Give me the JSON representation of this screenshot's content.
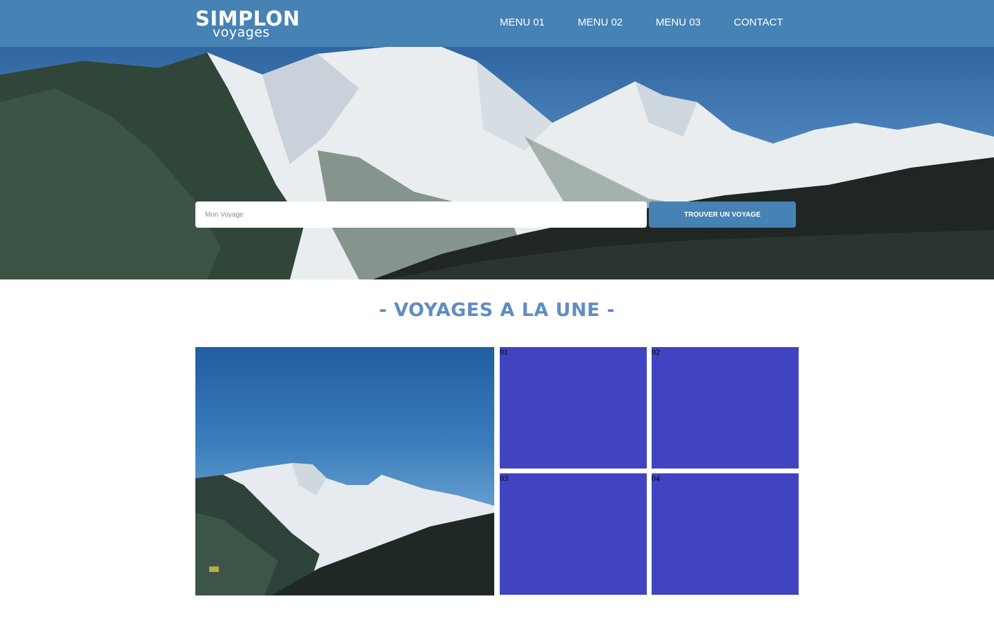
{
  "header": {
    "logo_main": "SIMPLON",
    "logo_sub": "voyages",
    "nav": [
      "MENU 01",
      "MENU 02",
      "MENU 03",
      "CONTACT"
    ]
  },
  "search": {
    "placeholder": "Mon Voyage",
    "button_label": "TROUVER UN VOYAGE"
  },
  "section": {
    "title": "- VOYAGES A LA UNE -"
  },
  "tiles": [
    "01",
    "02",
    "03",
    "04"
  ],
  "colors": {
    "header_bg": "#4682b4",
    "tile_bg": "#4044c0",
    "title": "#5f8dc2"
  }
}
